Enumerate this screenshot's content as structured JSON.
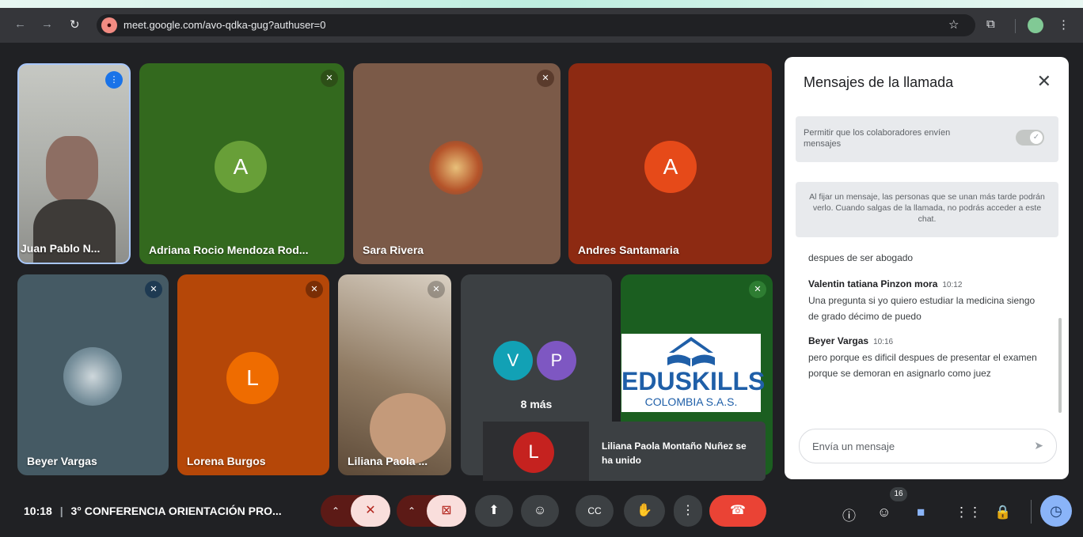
{
  "browser": {
    "url": "meet.google.com/avo-qdka-gug?authuser=0"
  },
  "participants": [
    {
      "name": "Juan Pablo N..."
    },
    {
      "name": "Adriana Rocio Mendoza Rod...",
      "initial": "A"
    },
    {
      "name": "Sara Rivera"
    },
    {
      "name": "Andres Santamaria",
      "initial": "A"
    },
    {
      "name": "Beyer Vargas"
    },
    {
      "name": "Lorena Burgos",
      "initial": "L"
    },
    {
      "name": "Liliana Paola ..."
    }
  ],
  "more_tile": {
    "initials": [
      "V",
      "P"
    ],
    "label": "8 más"
  },
  "logo": {
    "line1": "EDUSKILLS",
    "line2": "COLOMBIA S.A.S."
  },
  "toast": {
    "initial": "L",
    "text": "Liliana Paola Montaño Nuñez se ha unido"
  },
  "chat_panel": {
    "title": "Mensajes de la llamada",
    "toggle_label": "Permitir que los colaboradores envíen mensajes",
    "pin_info": "Al fijar un mensaje, las personas que se unan más tarde podrán verlo. Cuando salgas de la llamada, no podrás acceder a este chat.",
    "messages": [
      {
        "sender": "",
        "time": "",
        "text": "despues de ser abogado"
      },
      {
        "sender": "Valentin tatiana Pinzon mora",
        "time": "10:12",
        "text": "Una pregunta si yo quiero estudiar la medicina siengo de grado décimo de puedo"
      },
      {
        "sender": "Beyer Vargas",
        "time": "10:16",
        "text": "pero porque es dificil despues de presentar el examen porque se demoran en asignarlo como juez"
      }
    ],
    "input_placeholder": "Envía un mensaje"
  },
  "bottom_bar": {
    "time": "10:18",
    "meeting_title": "3° CONFERENCIA ORIENTACIÓN PRO...",
    "participant_count": "16"
  },
  "colors": {
    "end_call": "#ea4335",
    "muted_button": "#f9dedc",
    "chat_active": "#8ab4f8"
  }
}
